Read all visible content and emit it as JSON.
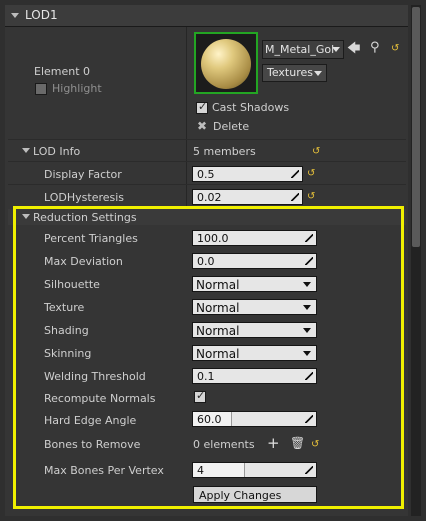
{
  "header": {
    "title": "LOD1"
  },
  "element": {
    "label": "Element 0",
    "highlight_label": "Highlight",
    "material_name": "M_Metal_Gol",
    "textures_label": "Textures",
    "cast_shadows_label": "Cast Shadows",
    "delete_label": "Delete"
  },
  "lod_info": {
    "label": "LOD Info",
    "members": "5 members",
    "display_factor_label": "Display Factor",
    "display_factor_value": "0.5",
    "hysteresis_label": "LODHysteresis",
    "hysteresis_value": "0.02"
  },
  "reduction": {
    "label": "Reduction Settings",
    "rows": {
      "percent_triangles": {
        "label": "Percent Triangles",
        "value": "100.0"
      },
      "max_deviation": {
        "label": "Max Deviation",
        "value": "0.0"
      },
      "silhouette": {
        "label": "Silhouette",
        "value": "Normal"
      },
      "texture": {
        "label": "Texture",
        "value": "Normal"
      },
      "shading": {
        "label": "Shading",
        "value": "Normal"
      },
      "skinning": {
        "label": "Skinning",
        "value": "Normal"
      },
      "welding_threshold": {
        "label": "Welding Threshold",
        "value": "0.1"
      },
      "recompute_normals": {
        "label": "Recompute Normals",
        "checked": true
      },
      "hard_edge_angle": {
        "label": "Hard Edge Angle",
        "value": "60.0"
      },
      "bones_to_remove": {
        "label": "Bones to Remove",
        "value": "0 elements"
      },
      "max_bones": {
        "label": "Max Bones Per Vertex",
        "value": "4"
      }
    },
    "apply_label": "Apply Changes"
  },
  "colors": {
    "highlight_box": "#f0f000",
    "thumbnail_border": "#23a523",
    "reset_arrow": "#e8c23a"
  }
}
